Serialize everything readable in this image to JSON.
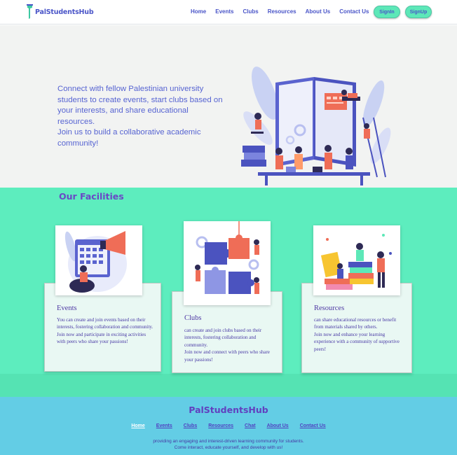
{
  "brand": {
    "name": "PalStudentsHub"
  },
  "nav": {
    "links": [
      "Home",
      "Events",
      "Clubs",
      "Resources",
      "About Us",
      "Contact Us"
    ],
    "signin": "SignIn",
    "signup": "SignUp"
  },
  "hero": {
    "line1": "Connect with fellow Palestinian university students to create events, start clubs based on your interests, and share educational resources.",
    "line2": "Join us to build a collaborative academic community!"
  },
  "facilities": {
    "title": "Our Facilities",
    "cards": [
      {
        "title": "Events",
        "desc1": "You can create and join events based on their interests, fostering collaboration and community.",
        "desc2": "Join now and participate in exciting activities with peers who share your passions!"
      },
      {
        "title": "Clubs",
        "desc1": "can create and join clubs based on their interests, fostering collaboration and community.",
        "desc2": "Join now and connect with peers who share your passions!"
      },
      {
        "title": "Resources",
        "desc1": "can share educational resources or benefit from materials shared by others.",
        "desc2": "Join now and enhance your learning experience with a community of supportive peers!"
      }
    ]
  },
  "footer": {
    "brand": "PalStudentsHub",
    "links": [
      "Home",
      "Events",
      "Clubs",
      "Resources",
      "Chat",
      "About Us",
      "Contact Us"
    ],
    "text1": "providing an engaging and interest-driven learning community for students.",
    "text2": "Come interact, educate yourself, and develop with us!"
  },
  "colors": {
    "primary": "#4a55c8",
    "accent": "#5dedbe",
    "footer": "#63cde5",
    "title": "#6a48c6"
  }
}
